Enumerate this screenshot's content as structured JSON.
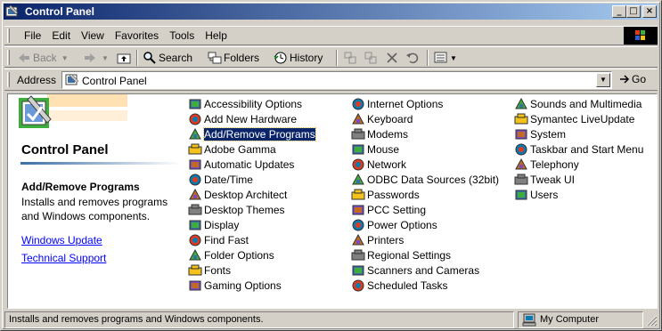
{
  "window": {
    "title": "Control Panel"
  },
  "titlebar_buttons": {
    "minimize": "_",
    "maximize": "□",
    "close": "×"
  },
  "menu": [
    {
      "label": "File",
      "key": "F",
      "rest": "ile"
    },
    {
      "label": "Edit",
      "key": "E",
      "rest": "dit"
    },
    {
      "label": "View",
      "key": "V",
      "rest": "iew"
    },
    {
      "label": "Favorites",
      "key": "a",
      "pre": "F",
      "rest": "vorites"
    },
    {
      "label": "Tools",
      "key": "T",
      "rest": "ools"
    },
    {
      "label": "Help",
      "key": "H",
      "rest": "elp"
    }
  ],
  "toolbar": {
    "back": "Back",
    "search": "Search",
    "folders": "Folders",
    "history": "History"
  },
  "address": {
    "label": "Address",
    "value": "Control Panel",
    "go": "Go"
  },
  "left_pane": {
    "title": "Control Panel",
    "selected_title": "Add/Remove Programs",
    "selected_desc": "Installs and removes programs and Windows components.",
    "links": [
      "Windows Update",
      "Technical Support"
    ]
  },
  "items": {
    "col1": [
      "Accessibility Options",
      "Add New Hardware",
      "Add/Remove Programs",
      "Adobe Gamma",
      "Automatic Updates",
      "Date/Time",
      "Desktop Architect",
      "Desktop Themes",
      "Display",
      "Find Fast",
      "Folder Options",
      "Fonts",
      "Gaming Options"
    ],
    "col2": [
      "Internet Options",
      "Keyboard",
      "Modems",
      "Mouse",
      "Network",
      "ODBC Data Sources (32bit)",
      "Passwords",
      "PCC Setting",
      "Power Options",
      "Printers",
      "Regional Settings",
      "Scanners and Cameras",
      "Scheduled Tasks"
    ],
    "col3": [
      "Sounds and Multimedia",
      "Symantec LiveUpdate",
      "System",
      "Taskbar and Start Menu",
      "Telephony",
      "Tweak UI",
      "Users"
    ],
    "selected": "Add/Remove Programs"
  },
  "status": {
    "text": "Installs and removes programs and Windows components.",
    "zone": "My Computer"
  },
  "colors": {
    "title_start": "#0a246a",
    "title_end": "#a6caf0",
    "face": "#d4d0c8",
    "link": "#0000ff"
  }
}
